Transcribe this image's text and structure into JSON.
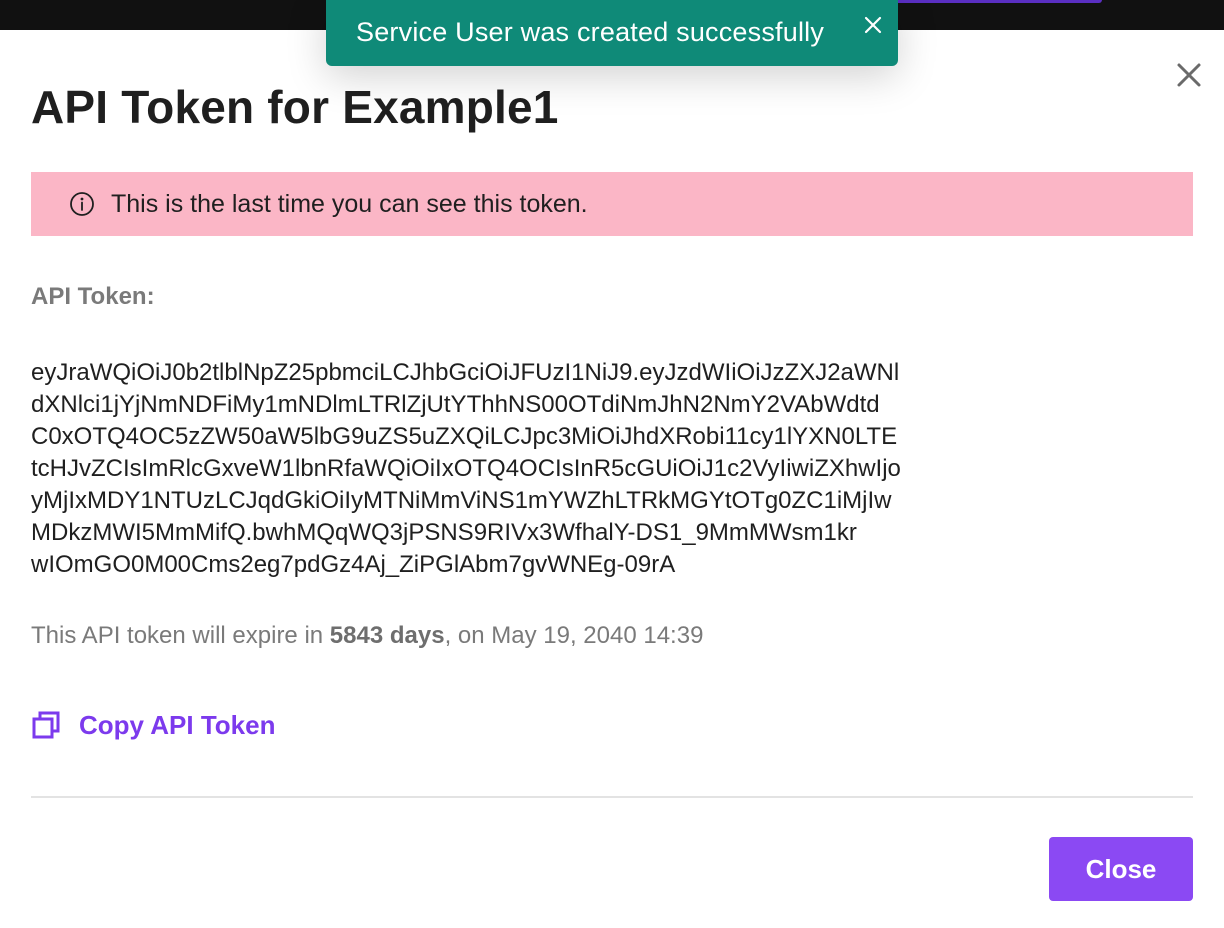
{
  "toast": {
    "message": "Service User was created successfully",
    "bg_color": "#0f8a78",
    "close_icon": "close-icon"
  },
  "modal": {
    "title": "API Token for Example1",
    "close_icon": "close-icon",
    "warning": {
      "text": "This is the last time you can see this token.",
      "icon": "info-icon",
      "bg_color": "#fbb6c6"
    },
    "token_label": "API Token:",
    "token_lines": [
      "eyJraWQiOiJ0b2tlblNpZ25pbmciLCJhbGciOiJFUzI1NiJ9.eyJzdWIiOiJzZXJ2aWNl",
      "dXNlci1jYjNmNDFiMy1mNDlmLTRlZjUtYThhNS00OTdiNmJhN2NmY2VAbWdtd",
      "C0xOTQ4OC5zZW50aW5lbG9uZS5uZXQiLCJpc3MiOiJhdXRobi11cy1lYXN0LTE",
      "tcHJvZCIsImRlcGxveW1lbnRfaWQiOiIxOTQ4OCIsInR5cGUiOiJ1c2VyIiwiZXhwIjo",
      "yMjIxMDY1NTUzLCJqdGkiOiIyMTNiMmViNS1mYWZhLTRkMGYtOTg0ZC1iMjIw",
      "MDkzMWI5MmMifQ.bwhMQqWQ3jPSNS9RIVx3WfhalY-DS1_9MmMWsm1kr",
      "wIOmGO0M00Cms2eg7pdGz4Aj_ZiPGlAbm7gvWNEg-09rA"
    ],
    "expiry": {
      "prefix": "This API token will expire in ",
      "days": "5843 days",
      "suffix": ", on May 19, 2040 14:39"
    },
    "copy": {
      "label": "Copy API Token",
      "icon": "copy-icon",
      "color": "#7c3aed"
    },
    "close_button": {
      "label": "Close",
      "color": "#8b49f3"
    }
  }
}
